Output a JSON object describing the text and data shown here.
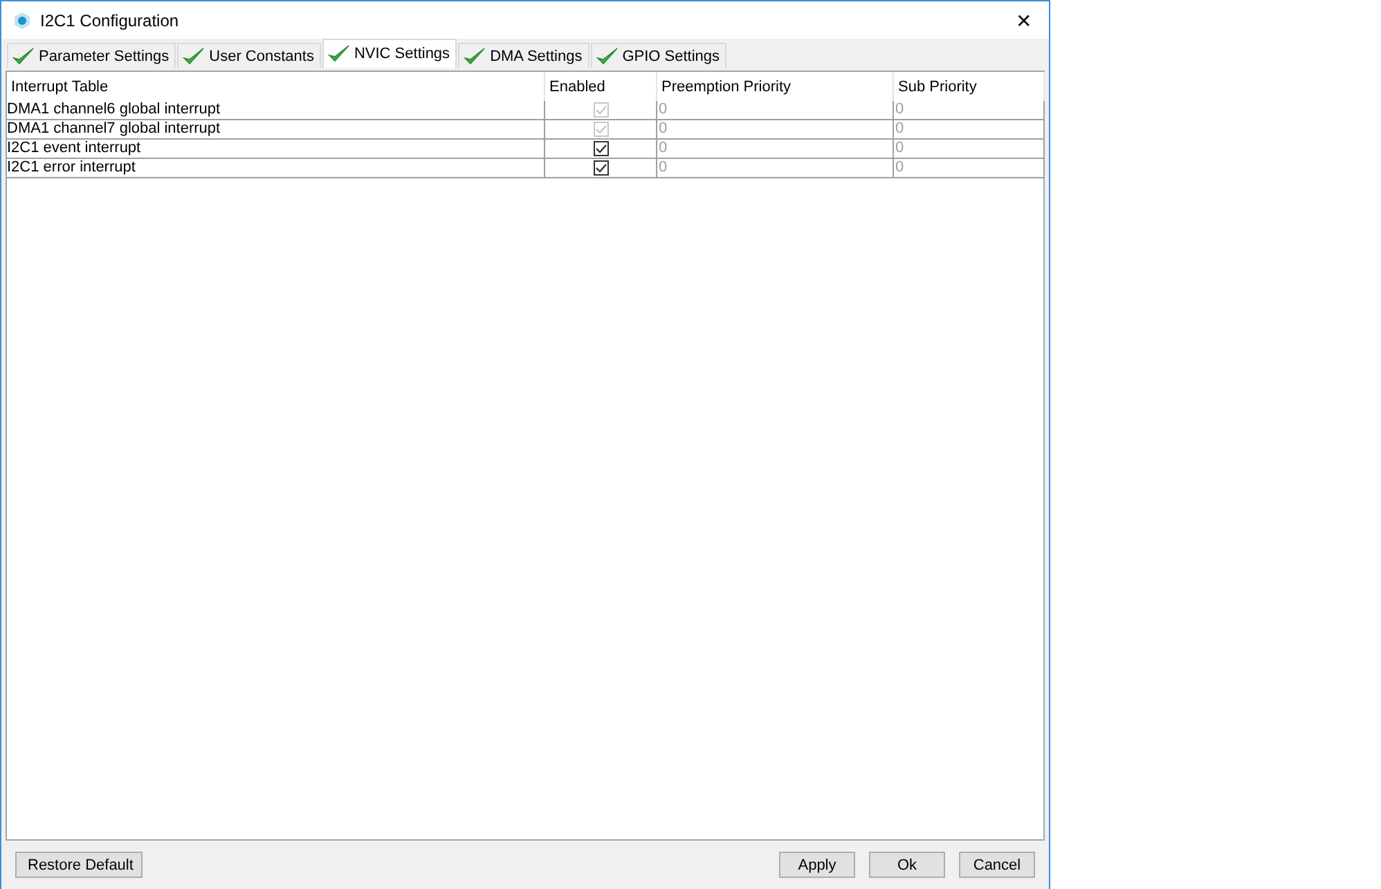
{
  "window": {
    "title": "I2C1 Configuration",
    "close": "✕"
  },
  "tabs": [
    {
      "label": "Parameter Settings",
      "selected": false
    },
    {
      "label": "User Constants",
      "selected": false
    },
    {
      "label": "NVIC Settings",
      "selected": true
    },
    {
      "label": "DMA Settings",
      "selected": false
    },
    {
      "label": "GPIO Settings",
      "selected": false
    }
  ],
  "table": {
    "columns": [
      "Interrupt Table",
      "Enabled",
      "Preemption Priority",
      "Sub Priority"
    ],
    "rows": [
      {
        "name": "DMA1 channel6 global interrupt",
        "checked": true,
        "disabled": true,
        "preemption": "0",
        "sub": "0"
      },
      {
        "name": "DMA1 channel7 global interrupt",
        "checked": true,
        "disabled": true,
        "preemption": "0",
        "sub": "0"
      },
      {
        "name": "I2C1 event interrupt",
        "checked": true,
        "disabled": false,
        "preemption": "0",
        "sub": "0"
      },
      {
        "name": "I2C1 error interrupt",
        "checked": true,
        "disabled": false,
        "preemption": "0",
        "sub": "0"
      }
    ]
  },
  "buttons": {
    "left": [
      "Restore Default"
    ],
    "right": [
      "Apply",
      "Ok",
      "Cancel"
    ]
  }
}
